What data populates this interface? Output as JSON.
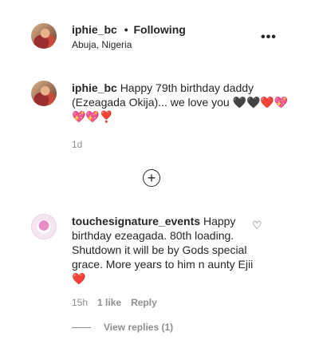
{
  "header": {
    "username": "iphie_bc",
    "separator": "•",
    "follow_status": "Following",
    "location": "Abuja, Nigeria",
    "more_icon": "more-horizontal-icon",
    "more_label": "•••"
  },
  "caption": {
    "username": "iphie_bc",
    "text": "Happy 79th birthday daddy (Ezeagada Okija)... we love you 🖤🖤❤️💖💖💖❣️",
    "age": "1d"
  },
  "load_more": {
    "icon": "plus-circle-icon",
    "label": "+"
  },
  "comment": {
    "username": "touchesignature_events",
    "text": "Happy birthday ezeagada. 80th loading. Shutdown it will be by Gods special grace. More years to him n aunty Ejii❤️",
    "age": "15h",
    "likes": "1 like",
    "reply_label": "Reply",
    "like_icon": "heart-outline-icon",
    "like_glyph": "♡"
  },
  "replies": {
    "label": "View replies (1)"
  }
}
